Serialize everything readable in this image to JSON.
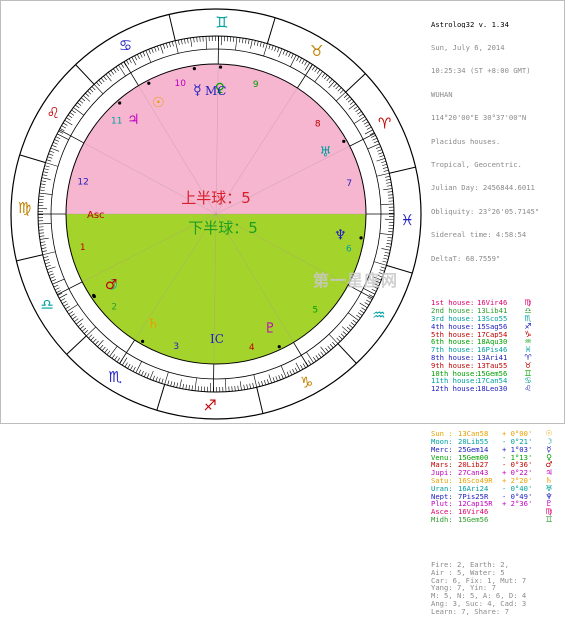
{
  "info": {
    "title": "Astrolog32 v. 1.34",
    "date": "Sun, July 6, 2014",
    "time": "10:25:34 (ST +8:00 GMT)",
    "place": "WUHAN",
    "coords": "114°20'00\"E 30°37'00\"N",
    "house_system": "Placidus houses.",
    "zodiac": "Tropical, Geocentric.",
    "julian": "Julian Day: 2456844.6011",
    "obliquity": "Obliquity: 23°26'05.7145\"",
    "sidereal": "Sidereal time: 4:58:54",
    "delta": "DeltaT: 68.7559\""
  },
  "houses": [
    {
      "label": "1st house:",
      "pos": "16Vir46",
      "color": "#e0006e",
      "glyph": "♍"
    },
    {
      "label": "2nd house:",
      "pos": "13Lib41",
      "color": "#2e9e2e",
      "glyph": "♎"
    },
    {
      "label": "3rd house:",
      "pos": "13Sco55",
      "color": "#00a0a0",
      "glyph": "♏"
    },
    {
      "label": "4th house:",
      "pos": "15Sag56",
      "color": "#2020c0",
      "glyph": "♐"
    },
    {
      "label": "5th house:",
      "pos": "17Cap54",
      "color": "#c00000",
      "glyph": "♑"
    },
    {
      "label": "6th house:",
      "pos": "18Aqu30",
      "color": "#00a000",
      "glyph": "♒"
    },
    {
      "label": "7th house:",
      "pos": "16Pis46",
      "color": "#00a0a0",
      "glyph": "♓"
    },
    {
      "label": "8th house:",
      "pos": "13Ari41",
      "color": "#2020c0",
      "glyph": "♈"
    },
    {
      "label": "9th house:",
      "pos": "13Tau55",
      "color": "#c00000",
      "glyph": "♉"
    },
    {
      "label": "10th house:",
      "pos": "15Gem56",
      "color": "#00a000",
      "glyph": "♊"
    },
    {
      "label": "11th house:",
      "pos": "17Can54",
      "color": "#00a0a0",
      "glyph": "♋"
    },
    {
      "label": "12th house:",
      "pos": "18Leo30",
      "color": "#2020c0",
      "glyph": "♌"
    }
  ],
  "planets": [
    {
      "name": "Sun :",
      "pos": "13Can58",
      "dec": "+ 0°00'",
      "color": "#e8a000",
      "glyph": "☉"
    },
    {
      "name": "Moon:",
      "pos": "20Lib55",
      "dec": "- 0°21'",
      "color": "#00a0a0",
      "glyph": "☽"
    },
    {
      "name": "Merc:",
      "pos": "25Gem14",
      "dec": "+ 1°03'",
      "color": "#2020c0",
      "glyph": "☿"
    },
    {
      "name": "Venu:",
      "pos": "15Gem00",
      "dec": "- 1°13'",
      "color": "#00a000",
      "glyph": "♀"
    },
    {
      "name": "Mars:",
      "pos": "20Lib27",
      "dec": "- 0°36'",
      "color": "#c00000",
      "glyph": "♂"
    },
    {
      "name": "Jupi:",
      "pos": "27Can43",
      "dec": "+ 0°22'",
      "color": "#c000c0",
      "glyph": "♃"
    },
    {
      "name": "Satu:",
      "pos": "16Sco49R",
      "dec": "+ 2°20'",
      "color": "#e8a000",
      "glyph": "♄"
    },
    {
      "name": "Uran:",
      "pos": "16Ari24",
      "dec": "- 0°40'",
      "color": "#00a0a0",
      "glyph": "♅"
    },
    {
      "name": "Nept:",
      "pos": "7Pis25R",
      "dec": "- 0°49'",
      "color": "#2020c0",
      "glyph": "♆"
    },
    {
      "name": "Plut:",
      "pos": "12Cap15R",
      "dec": "+ 2°36'",
      "color": "#c000c0",
      "glyph": "♇"
    },
    {
      "name": "Asce:",
      "pos": "16Vir46",
      "dec": "",
      "color": "#e0006e",
      "glyph": "♍"
    },
    {
      "name": "Midh:",
      "pos": "15Gem56",
      "dec": "",
      "color": "#2e9e2e",
      "glyph": "♊"
    }
  ],
  "summary": [
    "Fire: 2, Earth: 2,",
    "Air : 5, Water: 5",
    "Car: 6, Fix: 1, Mut: 7",
    "Yang: 7, Yin: 7",
    "M: 5, N: 5, A: 6, D: 4",
    "Ang: 3, Suc: 4, Cad: 3",
    "Learn: 7, Share: 7"
  ],
  "chart": {
    "upper_text": "上半球：5",
    "lower_text": "下半球：5",
    "upper_color": "#f6b6d0",
    "lower_color": "#a4d42c",
    "ring_color": "#ffffff",
    "upper_text_color": "#d81e28",
    "lower_text_color": "#1e9e1e",
    "asc_label": "Asc",
    "ic_label": "IC",
    "mc_label": "MC",
    "house_numbers": [
      "1",
      "2",
      "3",
      "4",
      "5",
      "6",
      "7",
      "8",
      "9",
      "10",
      "11",
      "12"
    ],
    "signs": [
      {
        "glyph": "♈",
        "icon": "aries-icon",
        "color": "#c00000"
      },
      {
        "glyph": "♉",
        "icon": "taurus-icon",
        "color": "#c08000"
      },
      {
        "glyph": "♊",
        "icon": "gemini-icon",
        "color": "#00a0a0"
      },
      {
        "glyph": "♋",
        "icon": "cancer-icon",
        "color": "#2020c0"
      },
      {
        "glyph": "♌",
        "icon": "leo-icon",
        "color": "#c00000"
      },
      {
        "glyph": "♍",
        "icon": "virgo-icon",
        "color": "#c08000"
      },
      {
        "glyph": "♎",
        "icon": "libra-icon",
        "color": "#00a0a0"
      },
      {
        "glyph": "♏",
        "icon": "scorpio-icon",
        "color": "#2020c0"
      },
      {
        "glyph": "♐",
        "icon": "sagittarius-icon",
        "color": "#c00000"
      },
      {
        "glyph": "♑",
        "icon": "capricorn-icon",
        "color": "#c08000"
      },
      {
        "glyph": "♒",
        "icon": "aquarius-icon",
        "color": "#00a0a0"
      },
      {
        "glyph": "♓",
        "icon": "pisces-icon",
        "color": "#2020c0"
      }
    ]
  },
  "watermark": "第一星座网"
}
